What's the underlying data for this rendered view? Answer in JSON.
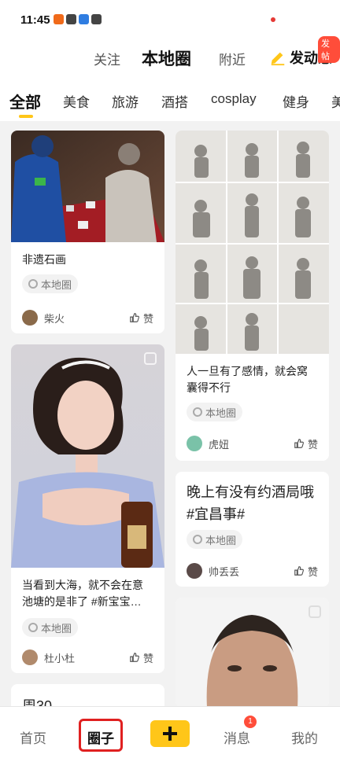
{
  "status": {
    "time": "11:45"
  },
  "header": {
    "tabs": [
      "关注",
      "本地圈",
      "附近"
    ],
    "post_label": "发动态",
    "post_badge": "发帖"
  },
  "categories": [
    "全部",
    "美食",
    "旅游",
    "酒搭",
    "cosplay",
    "健身",
    "美"
  ],
  "feed": {
    "left": [
      {
        "title": "非遗石画",
        "tag": "本地圈",
        "author": "柴火",
        "like": "赞"
      },
      {
        "title": "当看到大海，就不会在意池塘的是非了 #新宝宝…",
        "tag": "本地圈",
        "author": "杜小杜",
        "like": "赞"
      },
      {
        "title": "周30"
      }
    ],
    "right": [
      {
        "title": "人一旦有了感情，就会窝囊得不行",
        "tag": "本地圈",
        "author": "虎妞",
        "like": "赞"
      },
      {
        "title": "晚上有没有约酒局哦 #宜昌事#",
        "tag": "本地圈",
        "author": "帅丢丢",
        "like": "赞"
      }
    ]
  },
  "bottom_nav": {
    "items": [
      "首页",
      "圈子",
      "消息",
      "我的"
    ],
    "message_badge": "1"
  },
  "colors": {
    "accent": "#ffc619",
    "badge": "#ff4d3a",
    "highlight": "#e02020"
  }
}
